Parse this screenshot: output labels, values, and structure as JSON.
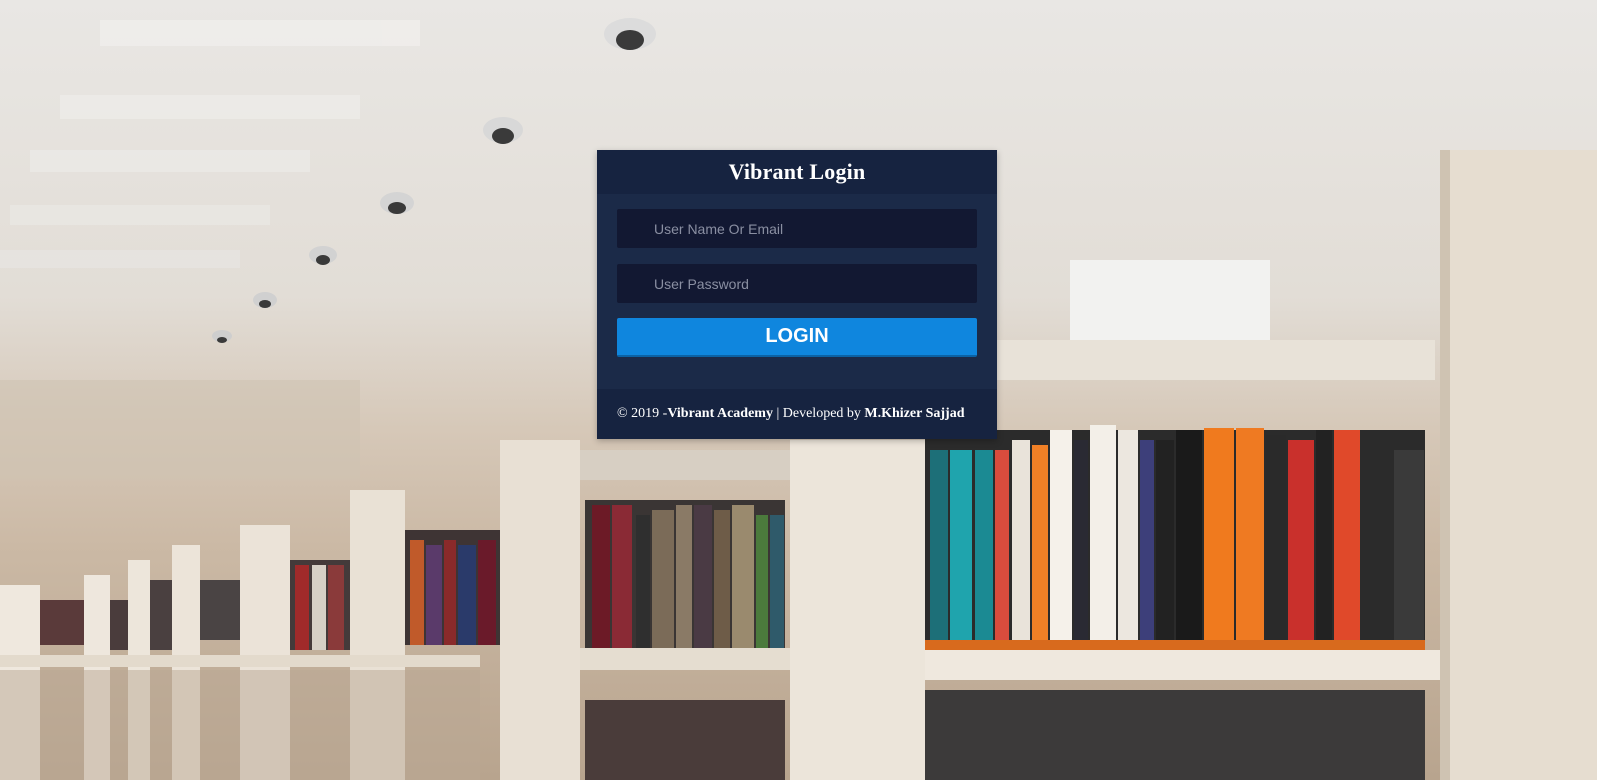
{
  "login": {
    "title": "Vibrant Login",
    "username_placeholder": "User Name Or Email",
    "password_placeholder": "User Password",
    "button_label": "LOGIN"
  },
  "footer": {
    "copyright": "© 2019 - ",
    "academy": "Vibrant Academy",
    "separator": " | Developed by ",
    "developer": "M.Khizer Sajjad"
  },
  "colors": {
    "card_background": "#1b2a48",
    "header_background": "#162340",
    "input_background": "#121832",
    "button_background": "#0f86de"
  }
}
